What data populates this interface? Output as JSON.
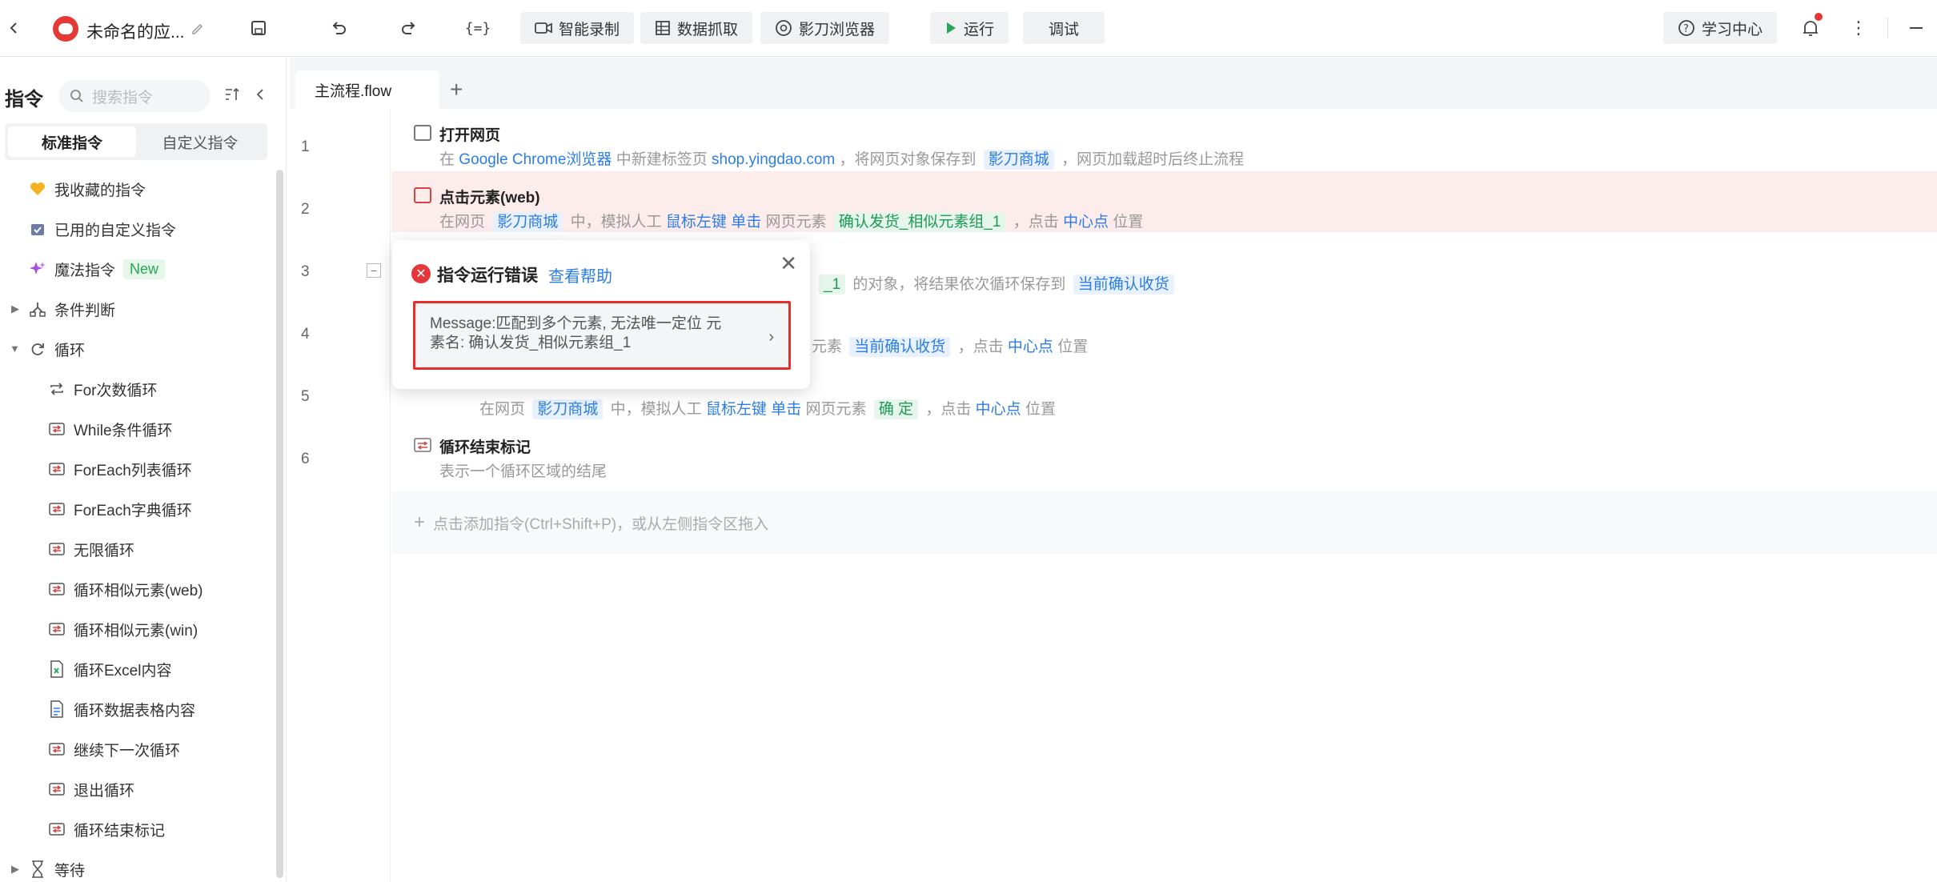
{
  "header": {
    "app_title": "未命名的应...",
    "smart_record": "智能录制",
    "data_scrape": "数据抓取",
    "browser": "影刀浏览器",
    "run": "运行",
    "debug": "调试",
    "learn_center": "学习中心"
  },
  "sidebar": {
    "title": "指令",
    "search_placeholder": "搜索指令",
    "tabs": [
      "标准指令",
      "自定义指令"
    ],
    "items": [
      {
        "label": "我收藏的指令"
      },
      {
        "label": "已用的自定义指令"
      },
      {
        "label": "魔法指令",
        "badge": "New"
      },
      {
        "label": "条件判断"
      },
      {
        "label": "循环"
      },
      {
        "label": "For次数循环"
      },
      {
        "label": "While条件循环"
      },
      {
        "label": "ForEach列表循环"
      },
      {
        "label": "ForEach字典循环"
      },
      {
        "label": "无限循环"
      },
      {
        "label": "循环相似元素(web)"
      },
      {
        "label": "循环相似元素(win)"
      },
      {
        "label": "循环Excel内容"
      },
      {
        "label": "循环数据表格内容"
      },
      {
        "label": "继续下一次循环"
      },
      {
        "label": "退出循环"
      },
      {
        "label": "循环结束标记"
      },
      {
        "label": "等待"
      }
    ]
  },
  "editor": {
    "tab_label": "主流程.flow",
    "line_numbers": [
      "1",
      "2",
      "3",
      "4",
      "5",
      "6"
    ],
    "row1": {
      "title": "打开网页",
      "d1": "在",
      "d2": "Google Chrome浏览器",
      "d3": "中新建标签页",
      "d4": "shop.yingdao.com",
      "d5": "，将网页对象保存到",
      "d6": "影刀商城",
      "d7": "，网页加载超时后终止流程"
    },
    "row2": {
      "title": "点击元素(web)",
      "d1": "在网页",
      "d2": "影刀商城",
      "d3": "中，模拟人工",
      "d4": "鼠标左键",
      "d5": "单击",
      "d6": "网页元素",
      "d7": "确认发货_相似元素组_1",
      "d8": "，点击",
      "d9": "中心点",
      "d10": "位置"
    },
    "row3": {
      "d1": "_1",
      "d2": "的对象，将结果依次循环保存到",
      "d3": "当前确认收货"
    },
    "row4": {
      "d1": "元素",
      "d2": "当前确认收货",
      "d3": "，点击",
      "d4": "中心点",
      "d5": "位置"
    },
    "row5": {
      "d1": "在网页",
      "d2": "影刀商城",
      "d3": "中，模拟人工",
      "d4": "鼠标左键",
      "d5": "单击",
      "d6": "网页元素",
      "d7": "确 定",
      "d8": "，点击",
      "d9": "中心点",
      "d10": "位置"
    },
    "row6": {
      "title": "循环结束标记",
      "desc": "表示一个循环区域的结尾"
    },
    "add_hint": "点击添加指令(Ctrl+Shift+P)，或从左侧指令区拖入"
  },
  "popup": {
    "title": "指令运行错误",
    "help": "查看帮助",
    "message_line1": "Message:匹配到多个元素, 无法唯一定位 元",
    "message_line2": "素名: 确认发货_相似元素组_1"
  },
  "colors": {
    "accent": "#2b7de9",
    "error": "#e5363a",
    "error_row_bg": "#fdecec"
  }
}
